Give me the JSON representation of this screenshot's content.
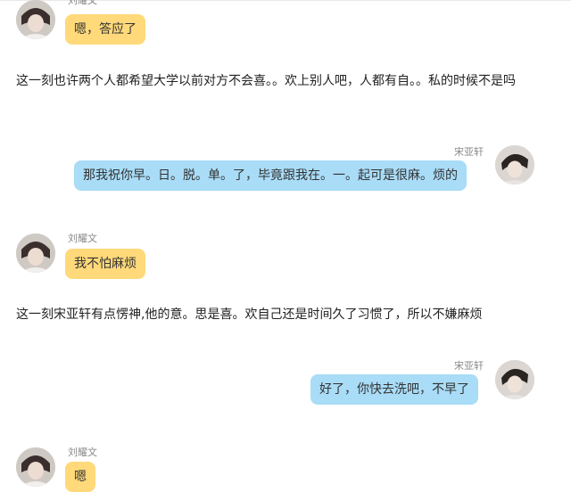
{
  "messages": [
    {
      "speaker": "刘耀文",
      "text": "嗯，答应了"
    },
    {
      "speaker": "宋亚轩",
      "text": "那我祝你早。日。脱。单。了，毕竟跟我在。一。起可是很麻。烦的"
    },
    {
      "speaker": "刘耀文",
      "text": "我不怕麻烦"
    },
    {
      "speaker": "宋亚轩",
      "text": "好了，你快去洗吧，不早了"
    },
    {
      "speaker": "刘耀文",
      "text": "嗯"
    }
  ],
  "narration": [
    "这一刻也许两个人都希望大学以前对方不会喜。。欢上别人吧，人都有自。。私的时候不是吗",
    "这一刻宋亚轩有点愣神,他的意。思是喜。欢自己还是时间久了习惯了，所以不嫌麻烦"
  ],
  "avatars": {
    "left_icon": "person-avatar-icon",
    "right_icon": "person-avatar-icon"
  },
  "colors": {
    "left_bubble": "#ffd97a",
    "right_bubble": "#a9dcf7",
    "name_text": "#888888"
  }
}
